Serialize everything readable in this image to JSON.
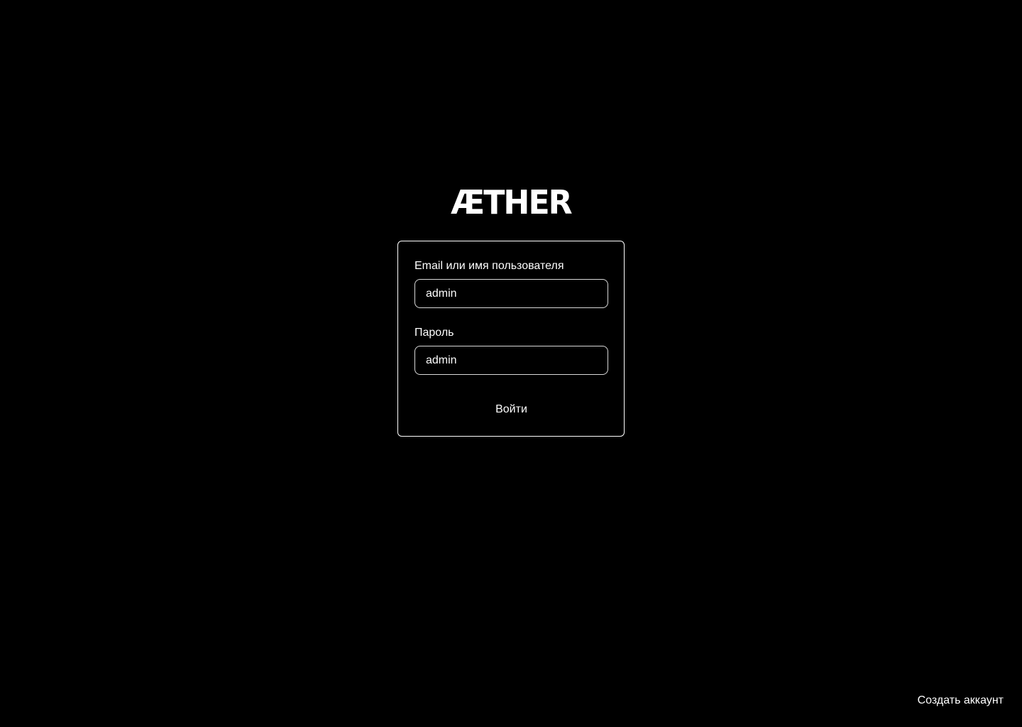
{
  "brand": {
    "logo_text": "ÆTHER"
  },
  "login_form": {
    "email_label": "Email или имя пользователя",
    "email_value": "admin",
    "password_label": "Пароль",
    "password_value": "admin",
    "submit_label": "Войти"
  },
  "footer": {
    "create_account_label": "Создать аккаунт"
  },
  "colors": {
    "background": "#000000",
    "foreground": "#ffffff",
    "input_border": "#d9d9d9"
  }
}
